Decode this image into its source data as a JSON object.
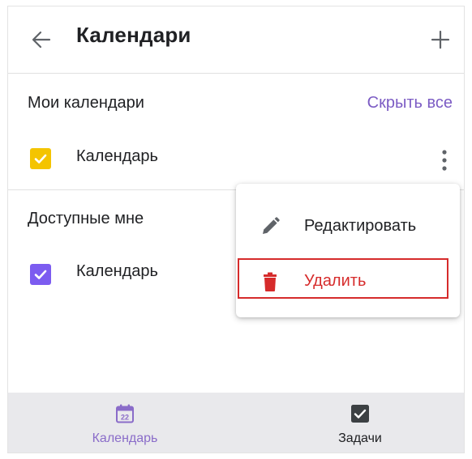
{
  "header": {
    "title": "Календари",
    "back_icon": "arrow-left-icon",
    "add_icon": "plus-icon"
  },
  "my_calendars": {
    "title": "Мои календари",
    "hide_all_label": "Скрыть все",
    "items": [
      {
        "label": "Календарь",
        "checked": true,
        "color": "#f4c400"
      }
    ]
  },
  "shared_calendars": {
    "title": "Доступные мне",
    "items": [
      {
        "label": "Календарь",
        "checked": true,
        "color": "#7c5cf0"
      }
    ]
  },
  "context_menu": {
    "items": [
      {
        "label": "Редактировать",
        "icon": "pencil-icon",
        "color": "#202124"
      },
      {
        "label": "Удалить",
        "icon": "trash-icon",
        "color": "#d62b2b"
      }
    ]
  },
  "bottom_nav": {
    "items": [
      {
        "label": "Календарь",
        "icon": "calendar-icon",
        "icon_number": "22",
        "active": true,
        "color": "#8a6cc9"
      },
      {
        "label": "Задачи",
        "icon": "task-checkbox-icon",
        "active": false,
        "color": "#202124"
      }
    ]
  },
  "colors": {
    "accent": "#7c5cc4",
    "danger": "#d62b2b",
    "nav_bg": "#e9e9ec"
  }
}
